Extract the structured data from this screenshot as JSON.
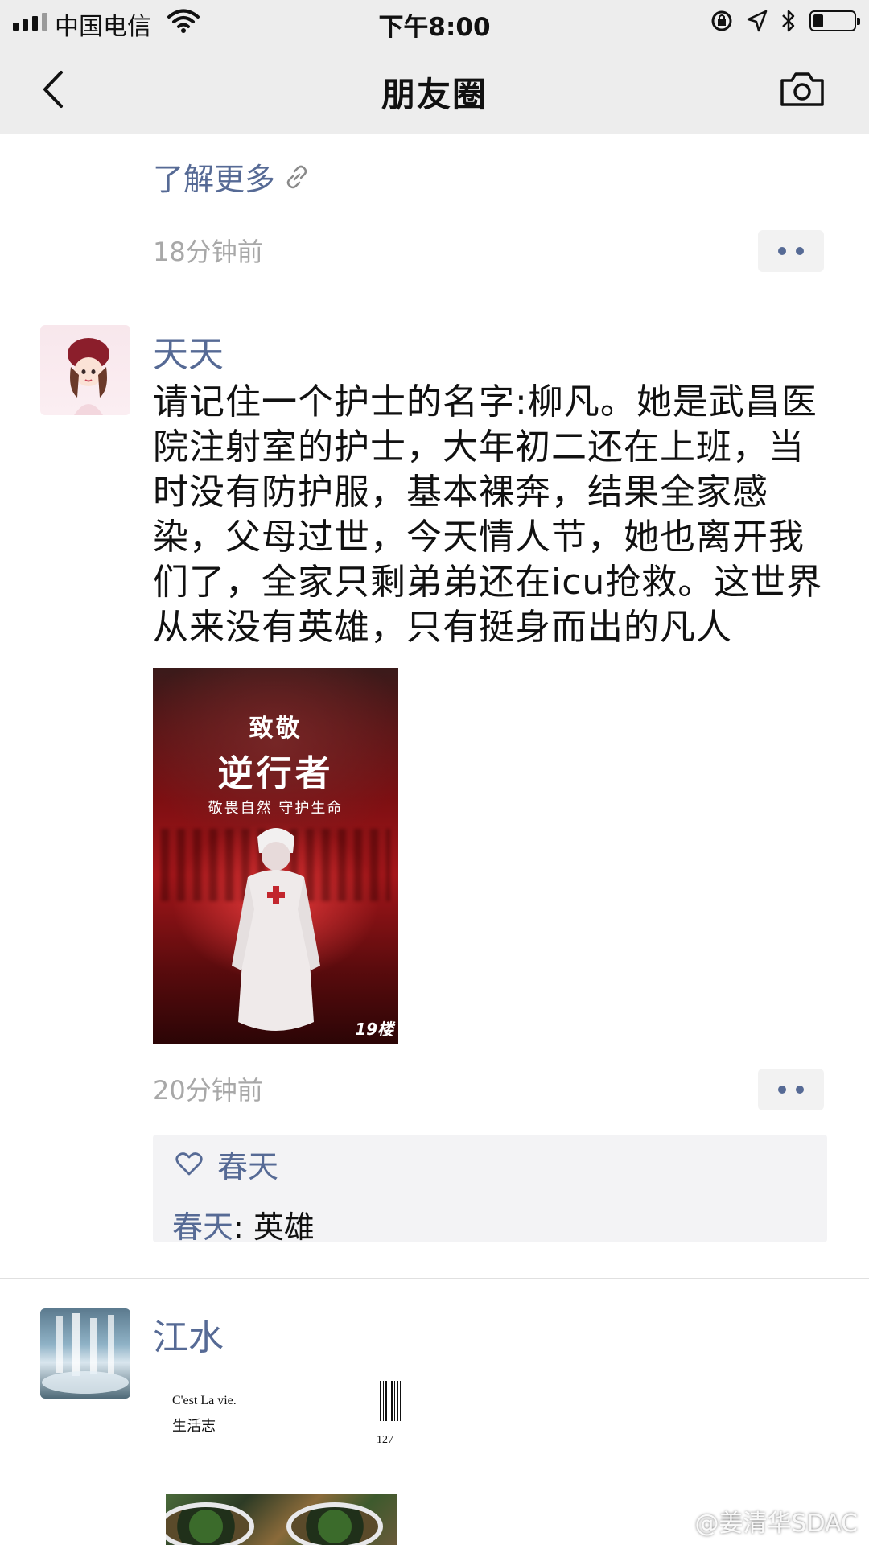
{
  "status_bar": {
    "carrier": "中国电信",
    "time": "下午8:00"
  },
  "nav": {
    "title": "朋友圈"
  },
  "prev_post": {
    "link_label": "了解更多",
    "time": "18分钟前"
  },
  "post": {
    "user": "天天",
    "text": "请记住一个护士的名字:柳凡。她是武昌医院注射室的护士，大年初二还在上班，当时没有防护服，基本裸奔，结果全家感染，父母过世，今天情人节，她也离开我们了，全家只剩弟弟还在icu抢救。这世界从来没有英雄，只有挺身而出的凡人",
    "image": {
      "line1": "致敬",
      "line2": "逆行者",
      "line3": "敬畏自然 守护生命",
      "mark": "19楼"
    },
    "time": "20分钟前",
    "likes": [
      "春天"
    ],
    "comments": [
      {
        "user": "春天",
        "sep": ":",
        "text": " 英雄"
      }
    ]
  },
  "next_post": {
    "user": "江水",
    "attach_line1": "C'est La vie.",
    "attach_line2": "生活志",
    "attach_number": "127"
  },
  "watermark": "@姜清华SDAC",
  "icons": [
    "signal-icon",
    "wifi-icon",
    "alarm-lock-icon",
    "location-icon",
    "bluetooth-icon",
    "battery-icon",
    "back-icon",
    "camera-icon",
    "link-icon",
    "more-icon",
    "heart-icon",
    "weibo-icon"
  ],
  "colors": {
    "link_blue": "#566a95",
    "nav_bg": "#ededed",
    "time_gray": "#a8a8a8",
    "like_bg": "#f3f3f5"
  }
}
